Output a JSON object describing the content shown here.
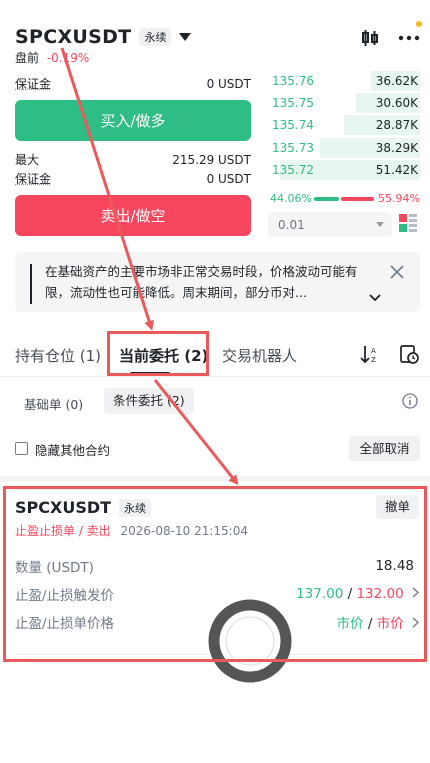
{
  "header": {
    "symbol": "SPCXUSDT",
    "contract_type": "永续",
    "premarket_label": "盘前",
    "change": "-0.19%"
  },
  "trade": {
    "margin_label": "保证金",
    "margin_value": "0 USDT",
    "buy_label": "买入/做多",
    "max_label": "最大",
    "max_value": "215.29 USDT",
    "margin2_label": "保证金",
    "margin2_value": "0 USDT",
    "sell_label": "卖出/做空"
  },
  "orderbook": {
    "rows": [
      {
        "price": "135.76",
        "qty": "36.62K",
        "depth": 0.32
      },
      {
        "price": "135.75",
        "qty": "30.60K",
        "depth": 0.42
      },
      {
        "price": "135.74",
        "qty": "28.87K",
        "depth": 0.5
      },
      {
        "price": "135.73",
        "qty": "38.29K",
        "depth": 0.66
      },
      {
        "price": "135.72",
        "qty": "51.42K",
        "depth": 0.92
      }
    ],
    "buy_ratio": "44.06%",
    "sell_ratio": "55.94%",
    "buy_fraction": 0.4406,
    "precision": "0.01"
  },
  "notice": {
    "text": "在基础资产的主要市场非正常交易时段，价格波动可能有限，流动性也可能降低。周末期间，部分币对..."
  },
  "tabs": {
    "positions": "持有仓位 (1)",
    "open_orders": "当前委托 (2)",
    "bots": "交易机器人"
  },
  "subtabs": {
    "basic": "基础单 (0)",
    "conditional": "条件委托 (2)"
  },
  "filter": {
    "hide_other": "隐藏其他合约",
    "cancel_all": "全部取消"
  },
  "order": {
    "symbol": "SPCXUSDT",
    "contract_type": "永续",
    "cancel_label": "撤单",
    "type_label": "止盈止损单 / 卖出",
    "time": "2026-08-10 21:15:04",
    "qty_label": "数量 (USDT)",
    "qty_value": "18.48",
    "trigger_label": "止盈/止损触发价",
    "tp_trigger": "137.00",
    "sep": "/",
    "sl_trigger": "132.00",
    "price_label": "止盈/止损单价格",
    "tp_price": "市价",
    "sl_price": "市价"
  },
  "colors": {
    "green": "#2ebd85",
    "red": "#f6465d",
    "annotation": "#ea5a5a"
  }
}
